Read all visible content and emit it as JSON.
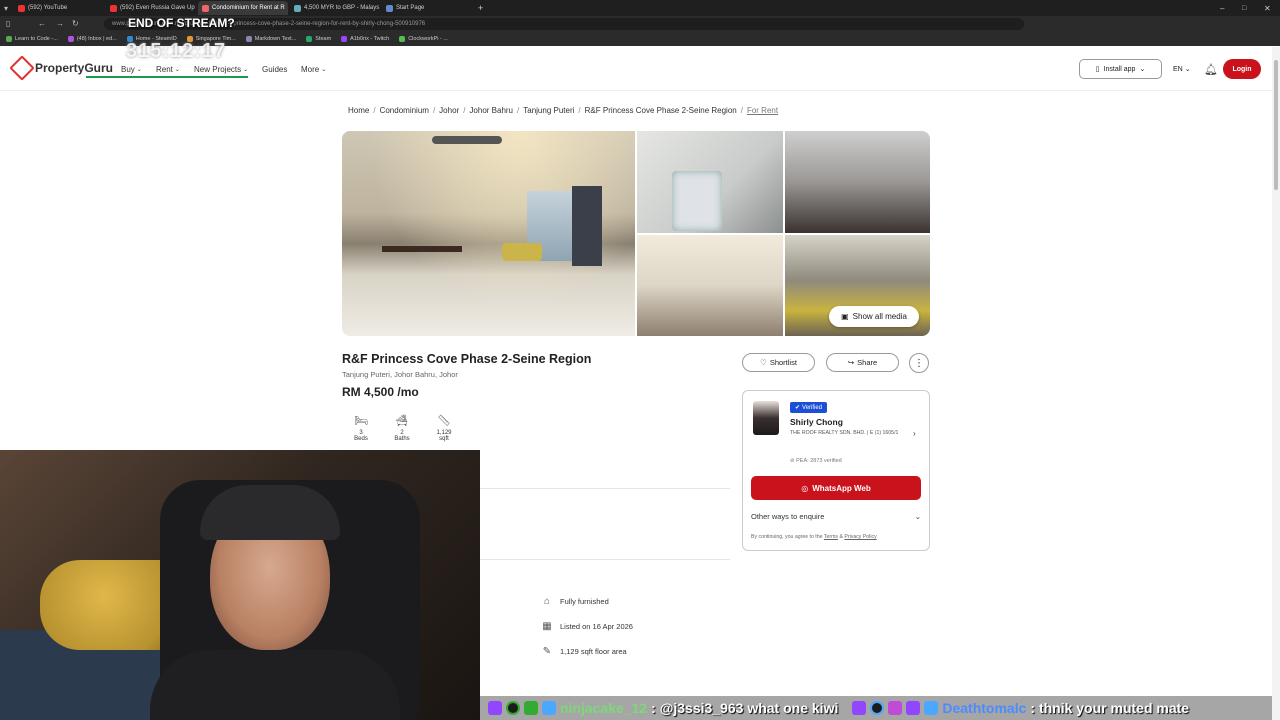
{
  "browser": {
    "tabs": [
      {
        "label": "(592) YouTube",
        "active": false
      },
      {
        "label": "(592) Even Russia Gave Up",
        "active": false
      },
      {
        "label": "Condominium for Rent at R",
        "active": true
      },
      {
        "label": "4,500 MYR to GBP - Malays",
        "active": false
      },
      {
        "label": "Start Page",
        "active": false
      }
    ],
    "new_tab_glyph": "+",
    "url": "www.propertyguru.com.my/property-listing/r-f-princess-cove-phase-2-seine-region-for-rent-by-shirly-chong-500910976",
    "bookmarks": [
      "Learn to Code -...",
      "(48) Inbox | ed...",
      "Home - SteamID",
      "Singapore Tim...",
      "Markdown Text...",
      "Steam",
      "A1b0rix - Twitch",
      "ClockworkPi - ..."
    ]
  },
  "overlay": {
    "stream_status": "END OF STREAM?",
    "timer": "315:12:17"
  },
  "header": {
    "brand": "PropertyGuru",
    "nav": [
      "Buy",
      "Rent",
      "New Projects",
      "Guides",
      "More"
    ],
    "install_app": "Install app",
    "language": "EN",
    "login": "Login"
  },
  "breadcrumb": [
    "Home",
    "Condominium",
    "Johor",
    "Johor Bahru",
    "Tanjung Puteri",
    "R&F Princess Cove Phase 2-Seine Region",
    "For Rent"
  ],
  "gallery": {
    "show_all_label": "Show all media"
  },
  "listing": {
    "title": "R&F Princess Cove Phase 2-Seine Region",
    "location": "Tanjung Puteri, Johor Bahru, Johor",
    "price": "RM 4,500 /mo",
    "shortlist": "Shortlist",
    "share": "Share",
    "features": [
      {
        "value": "3",
        "label": "Beds",
        "icon": "bed-icon"
      },
      {
        "value": "2",
        "label": "Baths",
        "icon": "bath-icon"
      },
      {
        "value": "1,129",
        "label": "sqft",
        "icon": "ruler-icon"
      }
    ],
    "details": [
      {
        "text": "Fully furnished",
        "icon": "sofa-icon"
      },
      {
        "text": "Listed on 16 Apr 2026",
        "icon": "calendar-icon"
      },
      {
        "text": "1,129 sqft floor area",
        "icon": "ruler-icon"
      }
    ]
  },
  "agent": {
    "verified": "Verified",
    "name": "Shirly Chong",
    "agency": "THE ROOF REALTY SDN. BHD. | E (1) 1605/1",
    "pea": "PEA: 2873 verified",
    "whatsapp": "WhatsApp Web",
    "other_ways": "Other ways to enquire",
    "terms_prefix": "By continuing, you agree to the",
    "terms_link": "Terms",
    "terms_and": "&",
    "privacy_link": "Privacy Policy"
  },
  "chat": {
    "messages": [
      {
        "user": "ninjacake_12",
        "text": ": @j3ssi3_963 what one kiwi",
        "color": "#7dd87a"
      },
      {
        "user": "Deathtomalc",
        "text": ": thnik your muted mate",
        "color": "#4a8cff"
      }
    ]
  }
}
